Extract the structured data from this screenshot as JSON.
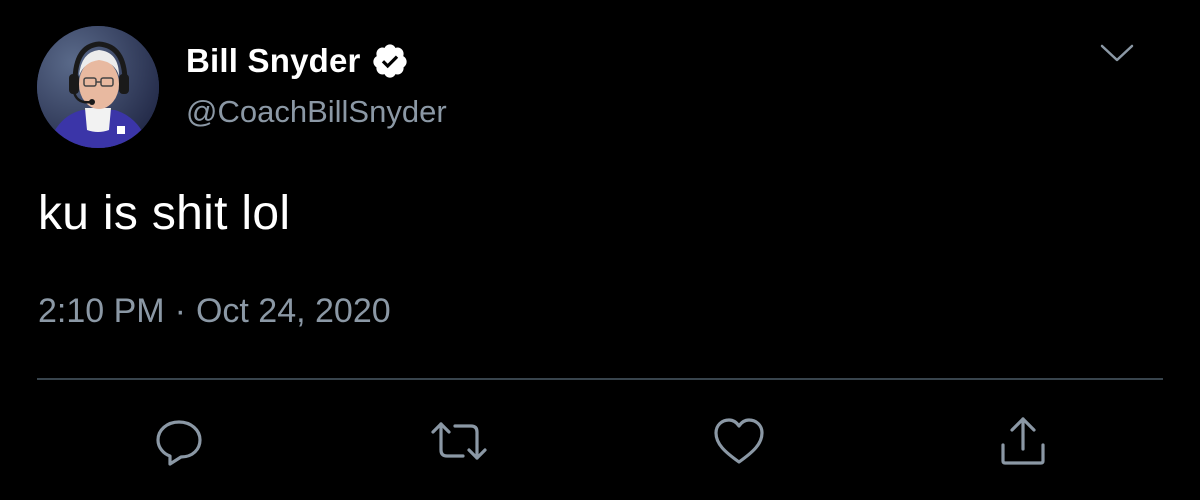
{
  "tweet": {
    "display_name": "Bill Snyder",
    "handle": "@CoachBillSnyder",
    "verified": true,
    "text": "ku is shit lol",
    "time": "2:10 PM",
    "separator": "·",
    "date": "Oct 24, 2020"
  },
  "icons": {
    "verified": "verified-badge-icon",
    "more": "chevron-down-icon",
    "reply": "reply-icon",
    "retweet": "retweet-icon",
    "like": "heart-icon",
    "share": "share-icon"
  },
  "colors": {
    "background": "#000000",
    "primary_text": "#ffffff",
    "secondary_text": "#8b98a5",
    "divider": "#38444d",
    "icon": "#8b98a5"
  }
}
